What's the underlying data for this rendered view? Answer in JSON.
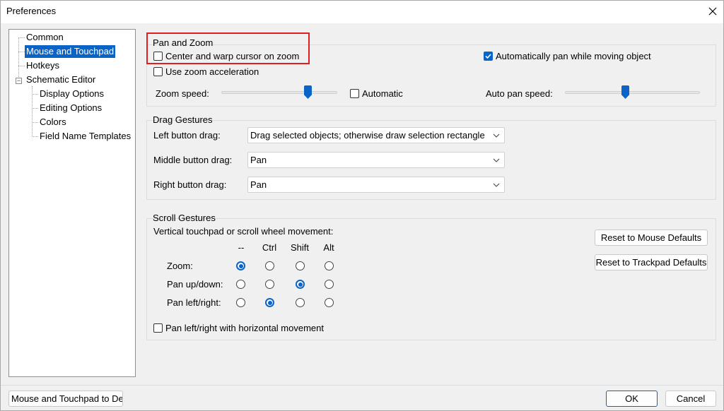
{
  "window": {
    "title": "Preferences"
  },
  "tree": {
    "items": [
      {
        "label": "Common"
      },
      {
        "label": "Mouse and Touchpad"
      },
      {
        "label": "Hotkeys"
      },
      {
        "label": "Schematic Editor"
      },
      {
        "label": "Display Options"
      },
      {
        "label": "Editing Options"
      },
      {
        "label": "Colors"
      },
      {
        "label": "Field Name Templates"
      }
    ],
    "expander_symbol": "−"
  },
  "pan_zoom": {
    "title": "Pan and Zoom",
    "center_warp_label": "Center and warp cursor on zoom",
    "center_warp_checked": false,
    "auto_pan_label": "Automatically pan while moving object",
    "auto_pan_checked": true,
    "zoom_accel_label": "Use zoom acceleration",
    "zoom_accel_checked": false,
    "zoom_speed_label": "Zoom speed:",
    "zoom_speed_level": 0.75,
    "automatic_label": "Automatic",
    "automatic_checked": false,
    "auto_pan_speed_label": "Auto pan speed:",
    "auto_pan_speed_level": 0.45
  },
  "drag": {
    "title": "Drag Gestures",
    "left_label": "Left button drag:",
    "left_value": "Drag selected objects; otherwise draw selection rectangle",
    "middle_label": "Middle button drag:",
    "middle_value": "Pan",
    "right_label": "Right button drag:",
    "right_value": "Pan"
  },
  "scroll": {
    "title": "Scroll Gestures",
    "subtitle": "Vertical touchpad or scroll wheel movement:",
    "columns": [
      "--",
      "Ctrl",
      "Shift",
      "Alt"
    ],
    "rows": [
      {
        "label": "Zoom:",
        "selected": 0
      },
      {
        "label": "Pan up/down:",
        "selected": 2
      },
      {
        "label": "Pan left/right:",
        "selected": 1
      }
    ],
    "horizontal_label": "Pan left/right with horizontal movement",
    "horizontal_checked": false,
    "reset_mouse_label": "Reset to Mouse Defaults",
    "reset_trackpad_label": "Reset to Trackpad Defaults"
  },
  "footer": {
    "reset_page_label": "Mouse and Touchpad to Defaults",
    "ok_label": "OK",
    "cancel_label": "Cancel"
  },
  "colors": {
    "accent": "#0a64c8",
    "highlight": "#e02020"
  }
}
